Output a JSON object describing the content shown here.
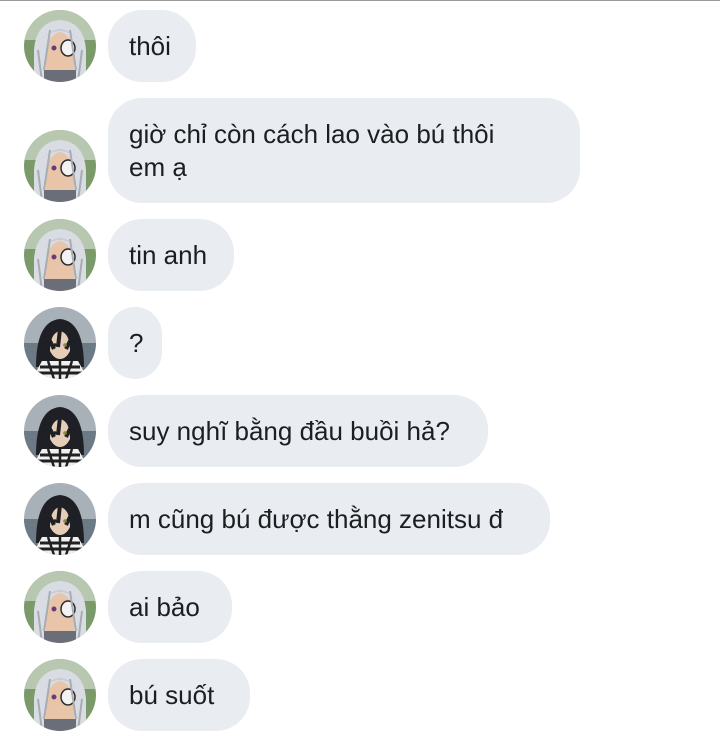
{
  "conversation": {
    "messages": [
      {
        "sender": "white-hair",
        "text": "thôi"
      },
      {
        "sender": "white-hair",
        "line1": "giờ chỉ còn cách lao vào bú thôi",
        "line2": "em ạ"
      },
      {
        "sender": "white-hair",
        "text": "tin anh"
      },
      {
        "sender": "black-hair",
        "text": "?"
      },
      {
        "sender": "black-hair",
        "text": "suy nghĩ bằng đầu buồi hả?"
      },
      {
        "sender": "black-hair",
        "text": "m cũng bú được thằng zenitsu đ"
      },
      {
        "sender": "white-hair",
        "text": "ai bảo"
      },
      {
        "sender": "white-hair",
        "text": "bú suốt"
      }
    ]
  },
  "colors": {
    "bubble_bg": "#e9ecf0",
    "text": "#1c1e21",
    "background": "#ffffff"
  },
  "icons": {
    "white_hair_avatar": "avatar-white-hair-character",
    "black_hair_avatar": "avatar-black-hair-character"
  }
}
